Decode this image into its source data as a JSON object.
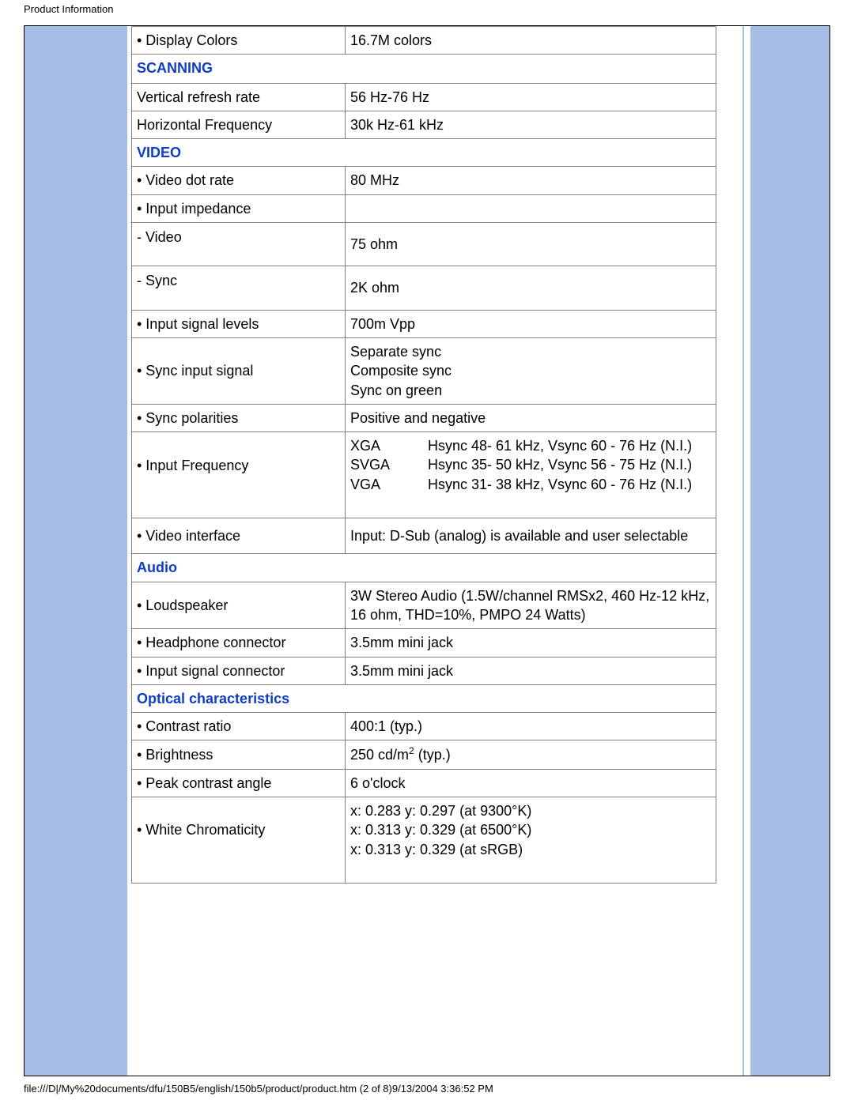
{
  "page_header": "Product Information",
  "footer": "file:///D|/My%20documents/dfu/150B5/english/150b5/product/product.htm (2 of 8)9/13/2004 3:36:52 PM",
  "r_display_colors_l": "• Display Colors",
  "r_display_colors_v": "16.7M colors",
  "sec_scanning": "SCANNING",
  "r_vertical_l": "Vertical refresh rate",
  "r_vertical_v": "56 Hz-76 Hz",
  "r_horizontal_l": "Horizontal Frequency",
  "r_horizontal_v": "30k Hz-61 kHz",
  "sec_video": "VIDEO",
  "r_vdr_l": "• Video dot rate",
  "r_vdr_v": "80 MHz",
  "r_impedance_l": "• Input impedance",
  "r_imp_video_l": "- Video",
  "r_imp_video_v": "75 ohm",
  "r_imp_sync_l": "- Sync",
  "r_imp_sync_v": "2K ohm",
  "r_isl_l": "• Input signal levels",
  "r_isl_v": "700m Vpp",
  "r_sync_input_l": "• Sync input signal",
  "r_sync_input_v1": "Separate sync",
  "r_sync_input_v2": "Composite sync",
  "r_sync_input_v3": "Sync on green",
  "r_sync_pol_l": "• Sync polarities",
  "r_sync_pol_v": "Positive and negative",
  "r_ifreq_l": "• Input Frequency",
  "r_ifreq_m1": "XGA",
  "r_ifreq_d1": "Hsync 48- 61 kHz, Vsync 60 - 76 Hz (N.I.)",
  "r_ifreq_m2": "SVGA",
  "r_ifreq_d2": "Hsync 35- 50 kHz, Vsync 56 - 75 Hz (N.I.)",
  "r_ifreq_m3": "VGA",
  "r_ifreq_d3": "Hsync 31- 38 kHz, Vsync 60 - 76 Hz (N.I.)",
  "r_vint_l": "• Video interface",
  "r_vint_v": "Input: D-Sub (analog) is available and user selectable",
  "sec_audio": "Audio",
  "r_loud_l": "• Loudspeaker",
  "r_loud_v": "3W Stereo Audio (1.5W/channel RMSx2, 460 Hz-12 kHz, 16 ohm, THD=10%, PMPO 24 Watts)",
  "r_head_l": "• Headphone connector",
  "r_head_v": "3.5mm mini jack",
  "r_isc_l": "• Input signal connector",
  "r_isc_v": "3.5mm mini jack",
  "sec_optical": "Optical characteristics",
  "r_contrast_l": "• Contrast ratio",
  "r_contrast_v": "400:1 (typ.)",
  "r_bright_l": "• Brightness",
  "r_bright_v": "250 cd/m",
  "r_bright_sup": "2",
  "r_bright_tail": " (typ.)",
  "r_peak_l": "• Peak contrast angle",
  "r_peak_v": "6 o'clock",
  "r_white_l": "• White Chromaticity",
  "r_white_v1": "x: 0.283 y: 0.297 (at 9300°K)",
  "r_white_v2": "x: 0.313 y: 0.329 (at 6500°K)",
  "r_white_v3": "x: 0.313 y: 0.329 (at sRGB)"
}
